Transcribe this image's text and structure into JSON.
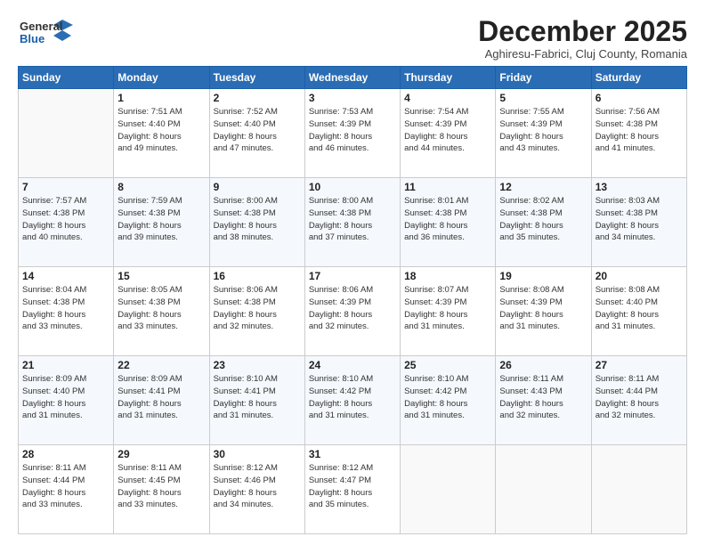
{
  "logo": {
    "general": "General",
    "blue": "Blue"
  },
  "header": {
    "month": "December 2025",
    "location": "Aghiresu-Fabrici, Cluj County, Romania"
  },
  "weekdays": [
    "Sunday",
    "Monday",
    "Tuesday",
    "Wednesday",
    "Thursday",
    "Friday",
    "Saturday"
  ],
  "weeks": [
    [
      {
        "day": "",
        "data": ""
      },
      {
        "day": "1",
        "data": "Sunrise: 7:51 AM\nSunset: 4:40 PM\nDaylight: 8 hours\nand 49 minutes."
      },
      {
        "day": "2",
        "data": "Sunrise: 7:52 AM\nSunset: 4:40 PM\nDaylight: 8 hours\nand 47 minutes."
      },
      {
        "day": "3",
        "data": "Sunrise: 7:53 AM\nSunset: 4:39 PM\nDaylight: 8 hours\nand 46 minutes."
      },
      {
        "day": "4",
        "data": "Sunrise: 7:54 AM\nSunset: 4:39 PM\nDaylight: 8 hours\nand 44 minutes."
      },
      {
        "day": "5",
        "data": "Sunrise: 7:55 AM\nSunset: 4:39 PM\nDaylight: 8 hours\nand 43 minutes."
      },
      {
        "day": "6",
        "data": "Sunrise: 7:56 AM\nSunset: 4:38 PM\nDaylight: 8 hours\nand 41 minutes."
      }
    ],
    [
      {
        "day": "7",
        "data": "Sunrise: 7:57 AM\nSunset: 4:38 PM\nDaylight: 8 hours\nand 40 minutes."
      },
      {
        "day": "8",
        "data": "Sunrise: 7:59 AM\nSunset: 4:38 PM\nDaylight: 8 hours\nand 39 minutes."
      },
      {
        "day": "9",
        "data": "Sunrise: 8:00 AM\nSunset: 4:38 PM\nDaylight: 8 hours\nand 38 minutes."
      },
      {
        "day": "10",
        "data": "Sunrise: 8:00 AM\nSunset: 4:38 PM\nDaylight: 8 hours\nand 37 minutes."
      },
      {
        "day": "11",
        "data": "Sunrise: 8:01 AM\nSunset: 4:38 PM\nDaylight: 8 hours\nand 36 minutes."
      },
      {
        "day": "12",
        "data": "Sunrise: 8:02 AM\nSunset: 4:38 PM\nDaylight: 8 hours\nand 35 minutes."
      },
      {
        "day": "13",
        "data": "Sunrise: 8:03 AM\nSunset: 4:38 PM\nDaylight: 8 hours\nand 34 minutes."
      }
    ],
    [
      {
        "day": "14",
        "data": "Sunrise: 8:04 AM\nSunset: 4:38 PM\nDaylight: 8 hours\nand 33 minutes."
      },
      {
        "day": "15",
        "data": "Sunrise: 8:05 AM\nSunset: 4:38 PM\nDaylight: 8 hours\nand 33 minutes."
      },
      {
        "day": "16",
        "data": "Sunrise: 8:06 AM\nSunset: 4:38 PM\nDaylight: 8 hours\nand 32 minutes."
      },
      {
        "day": "17",
        "data": "Sunrise: 8:06 AM\nSunset: 4:39 PM\nDaylight: 8 hours\nand 32 minutes."
      },
      {
        "day": "18",
        "data": "Sunrise: 8:07 AM\nSunset: 4:39 PM\nDaylight: 8 hours\nand 31 minutes."
      },
      {
        "day": "19",
        "data": "Sunrise: 8:08 AM\nSunset: 4:39 PM\nDaylight: 8 hours\nand 31 minutes."
      },
      {
        "day": "20",
        "data": "Sunrise: 8:08 AM\nSunset: 4:40 PM\nDaylight: 8 hours\nand 31 minutes."
      }
    ],
    [
      {
        "day": "21",
        "data": "Sunrise: 8:09 AM\nSunset: 4:40 PM\nDaylight: 8 hours\nand 31 minutes."
      },
      {
        "day": "22",
        "data": "Sunrise: 8:09 AM\nSunset: 4:41 PM\nDaylight: 8 hours\nand 31 minutes."
      },
      {
        "day": "23",
        "data": "Sunrise: 8:10 AM\nSunset: 4:41 PM\nDaylight: 8 hours\nand 31 minutes."
      },
      {
        "day": "24",
        "data": "Sunrise: 8:10 AM\nSunset: 4:42 PM\nDaylight: 8 hours\nand 31 minutes."
      },
      {
        "day": "25",
        "data": "Sunrise: 8:10 AM\nSunset: 4:42 PM\nDaylight: 8 hours\nand 31 minutes."
      },
      {
        "day": "26",
        "data": "Sunrise: 8:11 AM\nSunset: 4:43 PM\nDaylight: 8 hours\nand 32 minutes."
      },
      {
        "day": "27",
        "data": "Sunrise: 8:11 AM\nSunset: 4:44 PM\nDaylight: 8 hours\nand 32 minutes."
      }
    ],
    [
      {
        "day": "28",
        "data": "Sunrise: 8:11 AM\nSunset: 4:44 PM\nDaylight: 8 hours\nand 33 minutes."
      },
      {
        "day": "29",
        "data": "Sunrise: 8:11 AM\nSunset: 4:45 PM\nDaylight: 8 hours\nand 33 minutes."
      },
      {
        "day": "30",
        "data": "Sunrise: 8:12 AM\nSunset: 4:46 PM\nDaylight: 8 hours\nand 34 minutes."
      },
      {
        "day": "31",
        "data": "Sunrise: 8:12 AM\nSunset: 4:47 PM\nDaylight: 8 hours\nand 35 minutes."
      },
      {
        "day": "",
        "data": ""
      },
      {
        "day": "",
        "data": ""
      },
      {
        "day": "",
        "data": ""
      }
    ]
  ]
}
